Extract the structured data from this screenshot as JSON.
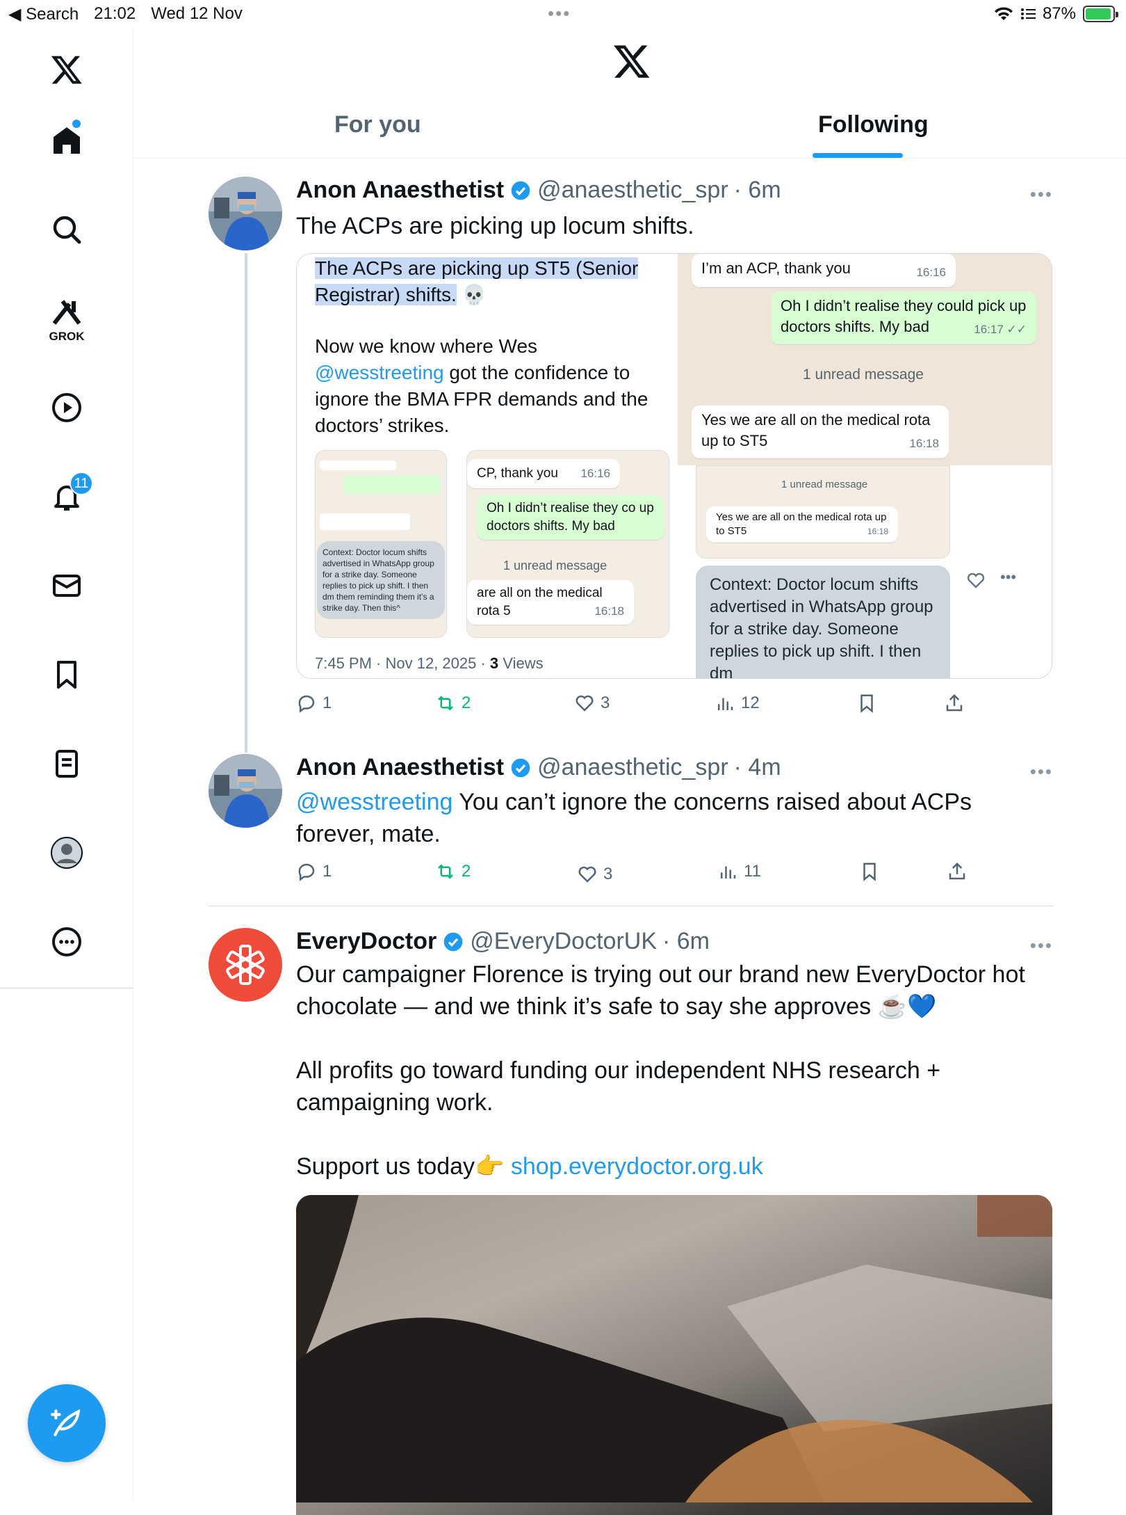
{
  "status": {
    "back_label": "◀ Search",
    "time": "21:02",
    "date": "Wed 12 Nov",
    "battery": "87%"
  },
  "sidebar": {
    "grok_label": "GROK",
    "notifications_count": "11",
    "icons": [
      "x-logo-icon",
      "home-icon",
      "search-icon",
      "grok-icon",
      "video-icon",
      "bell-icon",
      "mail-icon",
      "bookmark-icon",
      "lists-icon",
      "profile-icon",
      "more-icon"
    ]
  },
  "header": {
    "tabs": [
      {
        "label": "For you"
      },
      {
        "label": "Following"
      }
    ]
  },
  "tweets": [
    {
      "name": "Anon Anaesthetist",
      "handle": "@anaesthetic_spr",
      "time": "· 6m",
      "text": "The ACPs are picking up locum shifts.",
      "media": {
        "left_text_1": "The ACPs are picking up ST5 (Senior Registrar) shifts.",
        "skull": "💀",
        "left_text_2a": "Now we know where Wes",
        "left_link": "@wesstreeting",
        "left_text_2b": "got the confidence to ignore the BMA FPR demands and the doctors’ strikes.",
        "footer_time": "7:45 PM · Nov 12, 2025 ·",
        "footer_views_num": "3",
        "footer_views": "Views",
        "msg1": "I’m an ACP, thank you",
        "msg1_time": "16:16",
        "msg2": "Oh I didn’t realise they could pick up doctors shifts. My bad",
        "msg2_time": "16:17 ✓✓",
        "unread": "1 unread message",
        "msg3": "Yes we are all on the medical rota up to ST5",
        "msg3_time": "16:18",
        "mid_msg1": "CP, thank you",
        "mid_msg2": "Oh I didn’t realise they co up doctors shifts. My bad",
        "mid_msg3": "are all on the medical rota 5",
        "context": "Context: Doctor locum shifts advertised in WhatsApp group for a strike day. Someone replies to pick up shift. I then dm",
        "small_context": "Context: Doctor locum shifts advertised in WhatsApp group for a strike day. Someone replies to pick up shift. I then dm them reminding them it’s a strike day. Then this^"
      },
      "replies": "1",
      "reposts": "2",
      "likes": "3",
      "views": "12"
    },
    {
      "name": "Anon Anaesthetist",
      "handle": "@anaesthetic_spr",
      "time": "· 4m",
      "mention": "@wesstreeting",
      "text": " You can’t ignore the concerns raised about ACPs forever, mate.",
      "replies": "1",
      "reposts": "2",
      "likes": "3",
      "views": "11"
    },
    {
      "name": "EveryDoctor",
      "handle": "@EveryDoctorUK",
      "time": "· 6m",
      "text_p1": "Our campaigner Florence is trying out our brand new EveryDoctor hot chocolate — and we think it’s safe to say she approves ☕️💙",
      "text_p2": "All profits go toward funding our independent NHS research + campaigning work.",
      "text_p3": "Support us today👉 ",
      "link": "shop.everydoctor.org.uk"
    }
  ],
  "colors": {
    "accent": "#1d9bf0",
    "repost": "#00ba7c",
    "everydoctor": "#ef4b3b"
  }
}
